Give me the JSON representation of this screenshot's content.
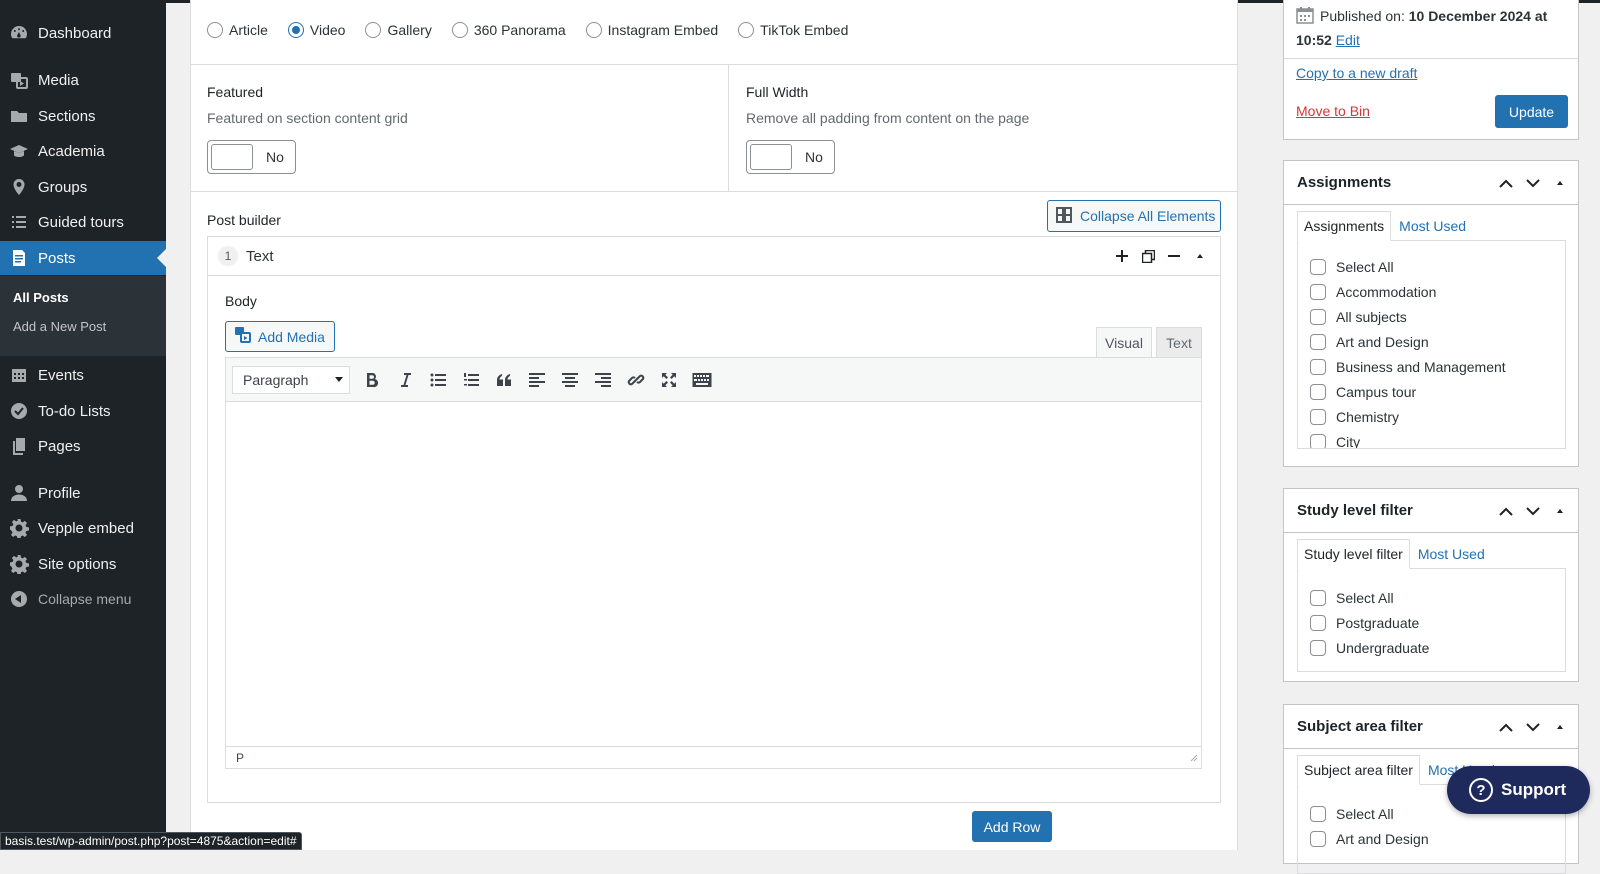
{
  "sidebar": {
    "items": [
      {
        "label": "Dashboard",
        "icon": "dashboard-icon"
      },
      {
        "label": "Media",
        "icon": "media-icon"
      },
      {
        "label": "Sections",
        "icon": "folder-icon"
      },
      {
        "label": "Academia",
        "icon": "graduation-cap-icon"
      },
      {
        "label": "Groups",
        "icon": "location-pin-icon"
      },
      {
        "label": "Guided tours",
        "icon": "list-icon"
      },
      {
        "label": "Posts",
        "icon": "document-icon"
      },
      {
        "label": "Events",
        "icon": "calendar-icon"
      },
      {
        "label": "To-do Lists",
        "icon": "checkmark-circle-icon"
      },
      {
        "label": "Pages",
        "icon": "pages-icon"
      },
      {
        "label": "Profile",
        "icon": "user-icon"
      },
      {
        "label": "Vepple embed",
        "icon": "gear-icon"
      },
      {
        "label": "Site options",
        "icon": "gear-icon"
      }
    ],
    "submenu": {
      "all_posts": "All Posts",
      "add_new": "Add a New Post"
    },
    "collapse_label": "Collapse menu"
  },
  "format": {
    "options": [
      "Article",
      "Video",
      "Gallery",
      "360 Panorama",
      "Instagram Embed",
      "TikTok Embed"
    ],
    "selected": "Video"
  },
  "featured": {
    "label": "Featured",
    "desc": "Featured on section content grid",
    "value": "No"
  },
  "full_width": {
    "label": "Full Width",
    "desc": "Remove all padding from content on the page",
    "value": "No"
  },
  "builder": {
    "label": "Post builder",
    "collapse_all": "Collapse All Elements",
    "module": {
      "number": "1",
      "title": "Text"
    },
    "body_label": "Body",
    "add_media": "Add Media",
    "tab_visual": "Visual",
    "tab_text": "Text",
    "format_select": "Paragraph",
    "path": "P",
    "add_row": "Add Row"
  },
  "publish": {
    "published_prefix": "Published on:",
    "published_date": "10 December 2024 at",
    "published_time": "10:52",
    "edit": "Edit",
    "copy_draft": "Copy to a new draft",
    "move_bin": "Move to Bin",
    "update": "Update"
  },
  "assignments": {
    "title": "Assignments",
    "tab_all": "Assignments",
    "tab_used": "Most Used",
    "items": [
      "Select All",
      "Accommodation",
      "All subjects",
      "Art and Design",
      "Business and Management",
      "Campus tour",
      "Chemistry",
      "City"
    ]
  },
  "study_level": {
    "title": "Study level filter",
    "tab_all": "Study level filter",
    "tab_used": "Most Used",
    "items": [
      "Select All",
      "Postgraduate",
      "Undergraduate"
    ]
  },
  "subject_area": {
    "title": "Subject area filter",
    "tab_all": "Subject area filter",
    "tab_used": "Most Used",
    "items": [
      "Select All",
      "Art and Design"
    ]
  },
  "support": {
    "label": "Support"
  },
  "status_url": "basis.test/wp-admin/post.php?post=4875&action=edit#",
  "colors": {
    "admin_bar": "#1d2327",
    "accent": "#2271b1",
    "danger": "#d63638",
    "support_bg": "#1f2a5c"
  }
}
